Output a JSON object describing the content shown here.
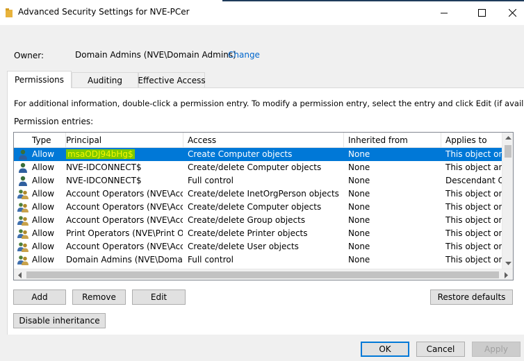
{
  "window": {
    "title": "Advanced Security Settings for NVE-PCer",
    "minimize_glyph": "—",
    "maximize_glyph": "☐",
    "close_glyph": "✕"
  },
  "owner": {
    "label": "Owner:",
    "value": "Domain Admins (NVE\\Domain Admins)",
    "change_link": "Change"
  },
  "tabs": [
    {
      "label": "Permissions",
      "active": true
    },
    {
      "label": "Auditing",
      "active": false
    },
    {
      "label": "Effective Access",
      "active": false
    }
  ],
  "info_text": "For additional information, double-click a permission entry. To modify a permission entry, select the entry and click Edit (if available).",
  "entries_label": "Permission entries:",
  "columns": {
    "type": "Type",
    "principal": "Principal",
    "access": "Access",
    "inherited": "Inherited from",
    "applies": "Applies to"
  },
  "rows": [
    {
      "icon": "user-icon",
      "type": "Allow",
      "principal": "msaODJ94bHg$",
      "access": "Create Computer objects",
      "inherited": "None",
      "applies": "This object only",
      "selected": true
    },
    {
      "icon": "user-icon",
      "type": "Allow",
      "principal": "NVE-IDCONNECT$",
      "access": "Create/delete Computer objects",
      "inherited": "None",
      "applies": "This object and",
      "selected": false
    },
    {
      "icon": "user-icon",
      "type": "Allow",
      "principal": "NVE-IDCONNECT$",
      "access": "Full control",
      "inherited": "None",
      "applies": "Descendant Co",
      "selected": false
    },
    {
      "icon": "group-icon",
      "type": "Allow",
      "principal": "Account Operators (NVE\\Acc...",
      "access": "Create/delete InetOrgPerson objects",
      "inherited": "None",
      "applies": "This object only",
      "selected": false
    },
    {
      "icon": "group-icon",
      "type": "Allow",
      "principal": "Account Operators (NVE\\Acc...",
      "access": "Create/delete Computer objects",
      "inherited": "None",
      "applies": "This object only",
      "selected": false
    },
    {
      "icon": "group-icon",
      "type": "Allow",
      "principal": "Account Operators (NVE\\Acc...",
      "access": "Create/delete Group objects",
      "inherited": "None",
      "applies": "This object only",
      "selected": false
    },
    {
      "icon": "group-icon",
      "type": "Allow",
      "principal": "Print Operators (NVE\\Print O...",
      "access": "Create/delete Printer objects",
      "inherited": "None",
      "applies": "This object only",
      "selected": false
    },
    {
      "icon": "group-icon",
      "type": "Allow",
      "principal": "Account Operators (NVE\\Acc...",
      "access": "Create/delete User objects",
      "inherited": "None",
      "applies": "This object only",
      "selected": false
    },
    {
      "icon": "group-icon",
      "type": "Allow",
      "principal": "Domain Admins (NVE\\Doma...",
      "access": "Full control",
      "inherited": "None",
      "applies": "This object only",
      "selected": false
    }
  ],
  "buttons": {
    "add": "Add",
    "remove": "Remove",
    "edit": "Edit",
    "restore": "Restore defaults",
    "disable": "Disable inheritance",
    "ok": "OK",
    "cancel": "Cancel",
    "apply": "Apply"
  },
  "colors": {
    "selection": "#0078d7",
    "link": "#0066cc",
    "highlight_marker": "#7cc900"
  }
}
